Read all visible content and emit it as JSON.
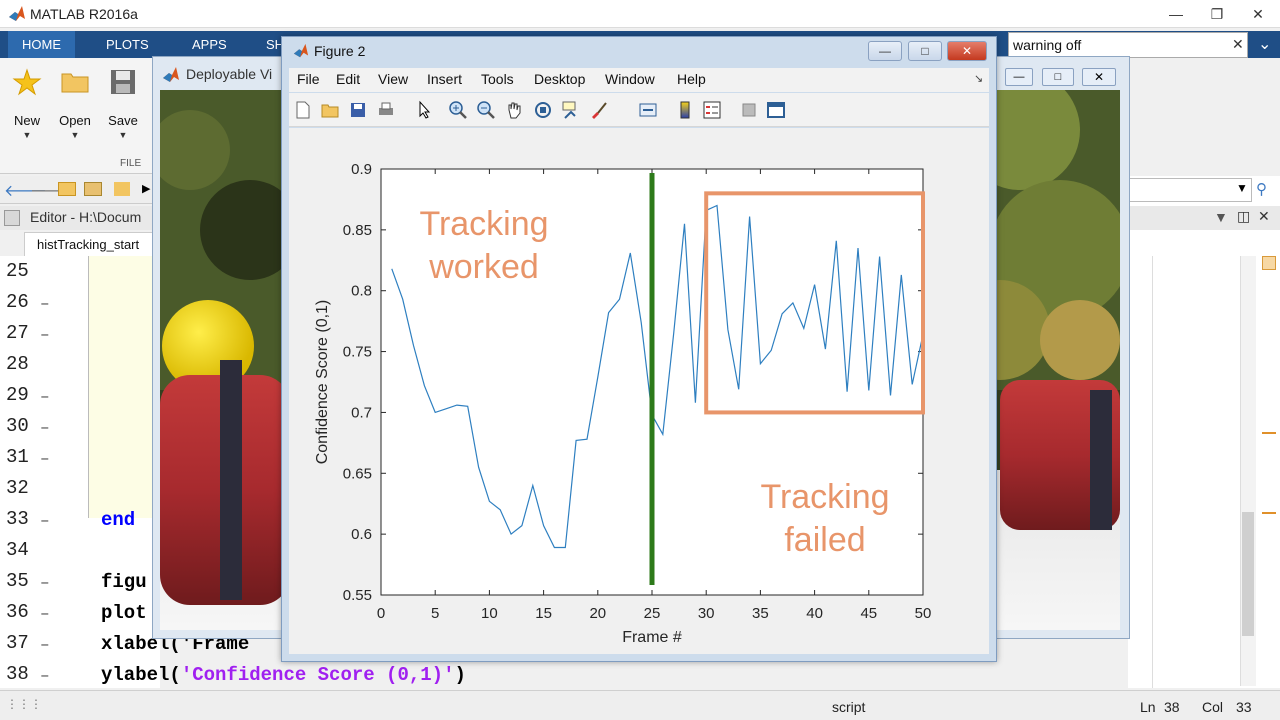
{
  "app": {
    "title": "MATLAB R2016a"
  },
  "ribbon": {
    "tabs": [
      "HOME",
      "PLOTS",
      "APPS",
      "SH"
    ],
    "buttons": [
      {
        "label": "New",
        "icon": "new-script-icon"
      },
      {
        "label": "Open",
        "icon": "open-folder-icon"
      },
      {
        "label": "Save",
        "icon": "save-icon"
      }
    ],
    "group_label": "FILE"
  },
  "command_search": {
    "value": "warning off"
  },
  "editor": {
    "header": "Editor - H:\\Docum",
    "tab": "histTracking_start",
    "lines": [
      {
        "n": "25",
        "code": ""
      },
      {
        "n": "26",
        "code": ""
      },
      {
        "n": "27",
        "code": ""
      },
      {
        "n": "28",
        "code": ""
      },
      {
        "n": "29",
        "code": ""
      },
      {
        "n": "30",
        "code": ""
      },
      {
        "n": "31",
        "code": ""
      },
      {
        "n": "32",
        "code": ""
      },
      {
        "n": "33",
        "code": "end"
      },
      {
        "n": "34",
        "code": ""
      },
      {
        "n": "35",
        "code": "figu"
      },
      {
        "n": "36",
        "code": "plot"
      },
      {
        "n": "37",
        "code": "xlabel('Frame"
      },
      {
        "n": "38",
        "code": "ylabel('Confidence Score (0,1)')"
      }
    ]
  },
  "status": {
    "mode": "script",
    "ln_label": "Ln",
    "ln": "38",
    "col_label": "Col",
    "col": "33"
  },
  "video_window": {
    "title": "Deployable Vi"
  },
  "figure": {
    "title": "Figure 2",
    "menus": [
      "File",
      "Edit",
      "View",
      "Insert",
      "Tools",
      "Desktop",
      "Window",
      "Help"
    ],
    "toolbar_icons": [
      "new-figure-icon",
      "open-icon",
      "save-icon",
      "print-icon",
      "pointer-icon",
      "zoom-in-icon",
      "zoom-out-icon",
      "pan-icon",
      "rotate-icon",
      "data-cursor-icon",
      "brush-icon",
      "link-icon",
      "colorbar-icon",
      "legend-icon",
      "hide-tools-icon",
      "dock-icon"
    ]
  },
  "chart_data": {
    "type": "line",
    "xlabel": "Frame #",
    "ylabel": "Confidence Score (0,1)",
    "xlim": [
      0,
      50
    ],
    "ylim": [
      0.55,
      0.9
    ],
    "xticks": [
      0,
      5,
      10,
      15,
      20,
      25,
      30,
      35,
      40,
      45,
      50
    ],
    "yticks": [
      0.55,
      0.6,
      0.65,
      0.7,
      0.75,
      0.8,
      0.85,
      0.9
    ],
    "series": [
      {
        "color": "#2e7fc0",
        "x": [
          1,
          2,
          3,
          4,
          5,
          6,
          7,
          8,
          9,
          10,
          11,
          12,
          13,
          14,
          15,
          16,
          17,
          18,
          19,
          20,
          21,
          22,
          23,
          24,
          25,
          26,
          27,
          28,
          29,
          30,
          31,
          32,
          33,
          34,
          35,
          36,
          37,
          38,
          39,
          40,
          41,
          42,
          43,
          44,
          45,
          46,
          47,
          48,
          49,
          50
        ],
        "y": [
          0.818,
          0.793,
          0.755,
          0.722,
          0.7,
          0.703,
          0.706,
          0.705,
          0.655,
          0.627,
          0.62,
          0.6,
          0.607,
          0.64,
          0.607,
          0.589,
          0.589,
          0.677,
          0.678,
          0.729,
          0.782,
          0.793,
          0.831,
          0.774,
          0.698,
          0.682,
          0.765,
          0.855,
          0.708,
          0.866,
          0.87,
          0.768,
          0.719,
          0.861,
          0.74,
          0.751,
          0.781,
          0.79,
          0.769,
          0.805,
          0.752,
          0.841,
          0.717,
          0.835,
          0.718,
          0.828,
          0.714,
          0.813,
          0.723,
          0.764
        ]
      }
    ],
    "vline": {
      "x": 25,
      "color": "#2d7a1a"
    },
    "annotations": [
      {
        "text": [
          "Tracking",
          "worked"
        ],
        "color": "#e8956a"
      },
      {
        "text": [
          "Tracking",
          "failed"
        ],
        "color": "#e8956a"
      }
    ],
    "highlight_box": {
      "x_range": [
        30,
        50
      ],
      "y_range": [
        0.7,
        0.88
      ],
      "color": "#e8956a"
    }
  }
}
